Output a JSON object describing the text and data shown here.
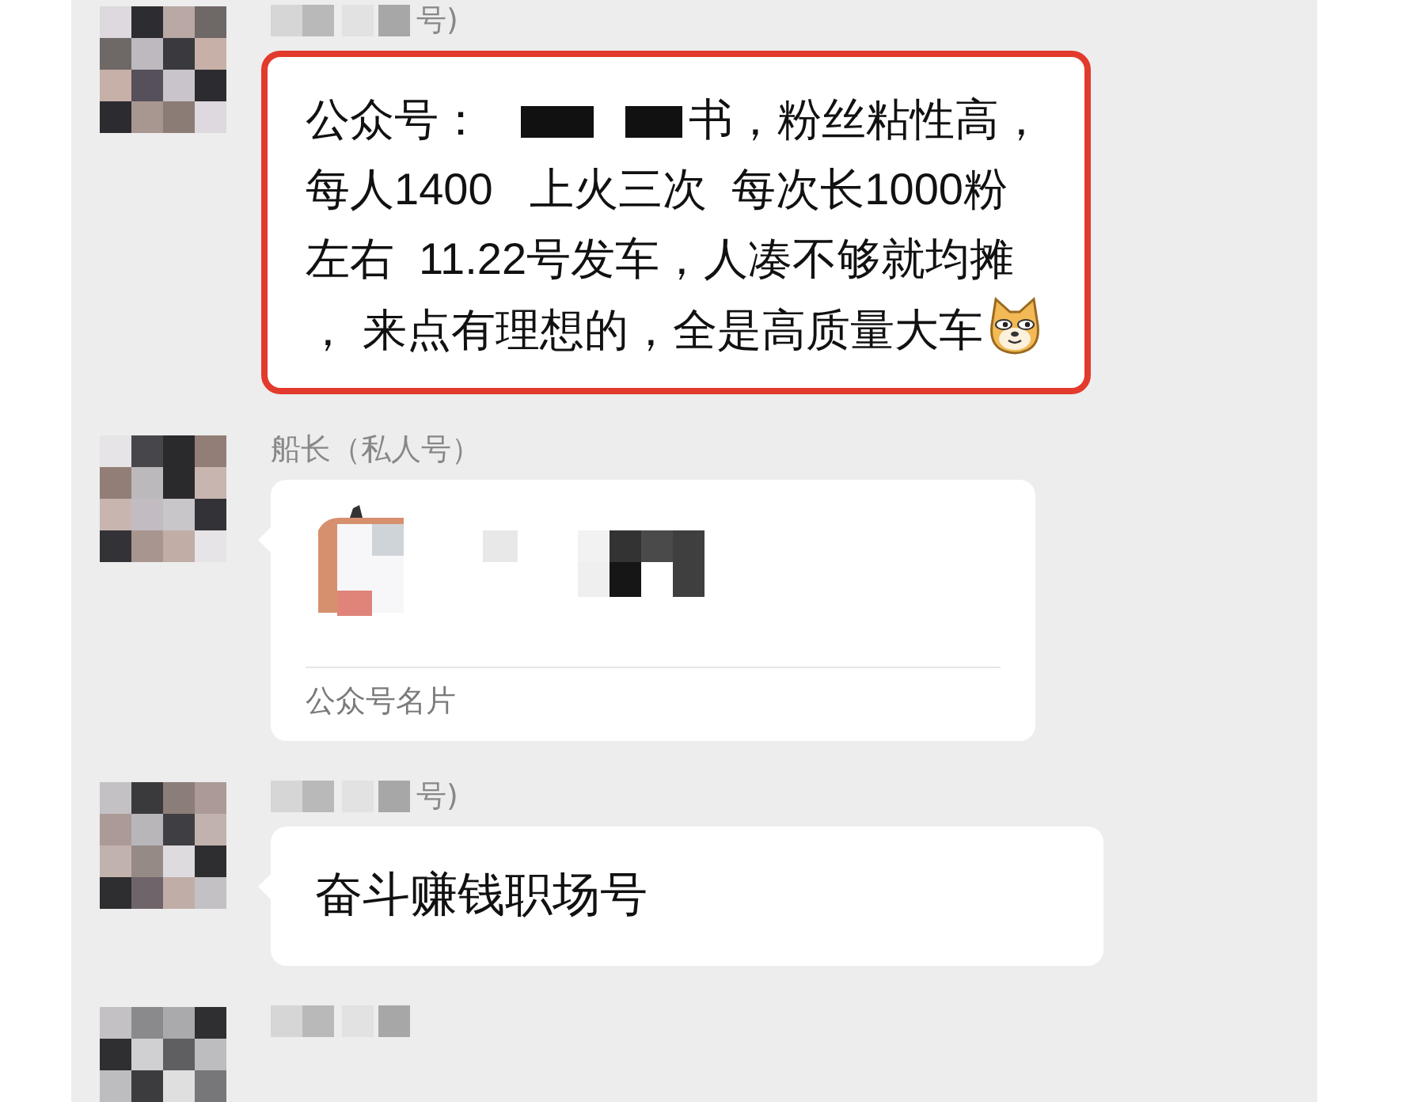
{
  "messages": [
    {
      "kind": "text",
      "highlighted": true,
      "sender": {
        "masked": true,
        "name": "号)"
      },
      "parts": [
        {
          "kind": "text",
          "text": "公众号："
        },
        {
          "kind": "redaction"
        },
        {
          "kind": "text",
          "text": "书，粉丝粘性高，每人1400   上火三次  每次长1000粉左右  11.22号发车，人凑不够就均摊， 来点有理想的，全是高质量大车"
        },
        {
          "kind": "emoji"
        }
      ]
    },
    {
      "kind": "card",
      "highlighted": false,
      "sender": {
        "masked": false,
        "name": "船长（私人号）"
      },
      "card": {
        "label": "公众号名片"
      }
    },
    {
      "kind": "text",
      "highlighted": false,
      "sender": {
        "masked": true,
        "name": "号)"
      },
      "parts": [
        {
          "kind": "text",
          "text": "奋斗赚钱职场号"
        }
      ]
    },
    {
      "kind": "partial",
      "highlighted": false,
      "sender": {
        "masked": true
      }
    }
  ]
}
